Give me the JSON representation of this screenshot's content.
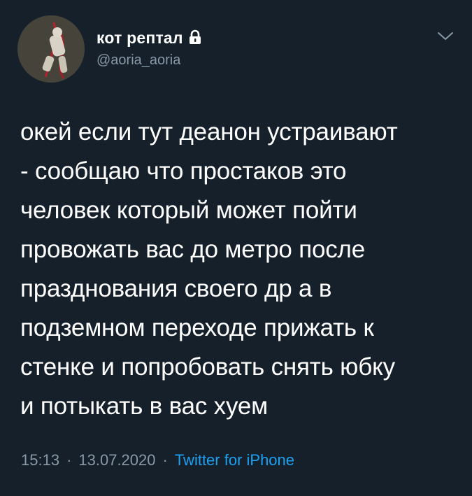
{
  "author": {
    "display_name": "кот рептал",
    "handle": "@aoria_aoria",
    "lock_icon": "lock-icon",
    "avatar_icon": "avatar-image"
  },
  "tweet": {
    "text": "окей если тут деанон устраивают\n- сообщаю что простаков это\nчеловек который может пойти\nпровожать вас до метро после\nпразднования своего др а в\nподземном переходе прижать к\nстенке и попробовать снять юбку\nи потыкать в вас хуем",
    "time": "15:13",
    "date": "13.07.2020",
    "separator": "·",
    "source": "Twitter for iPhone"
  },
  "menu": {
    "icon": "chevron-down-icon"
  },
  "colors": {
    "background": "#15202b",
    "secondary_text": "#8899a6",
    "link": "#1da1f2"
  }
}
